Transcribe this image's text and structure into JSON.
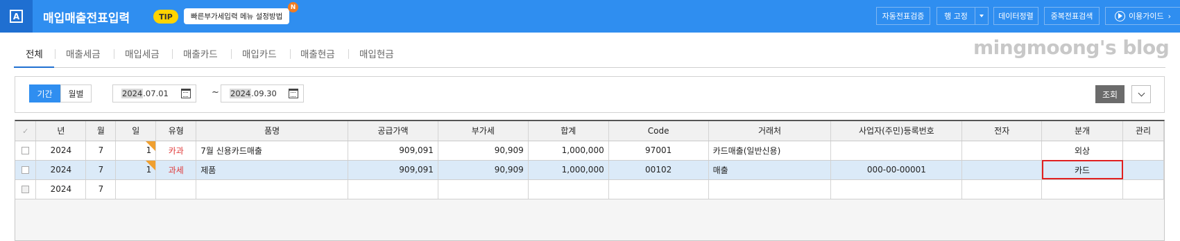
{
  "header": {
    "logo_letter": "A",
    "title": "매입매출전표입력",
    "tip_label": "TIP",
    "tip_text": "빠른부가세입력 메뉴 설정방법",
    "tip_new_badge": "N",
    "buttons": {
      "auto_verify": "자동전표검증",
      "row_fix": "행 고정",
      "data_sort": "데이터정렬",
      "dup_search": "중복전표검색",
      "guide": "이용가이드"
    }
  },
  "tabs": [
    {
      "label": "전체",
      "active": true
    },
    {
      "label": "매출세금",
      "active": false
    },
    {
      "label": "매입세금",
      "active": false
    },
    {
      "label": "매출카드",
      "active": false
    },
    {
      "label": "매입카드",
      "active": false
    },
    {
      "label": "매출현금",
      "active": false
    },
    {
      "label": "매입현금",
      "active": false
    }
  ],
  "watermark": "mingmoong's blog",
  "filter": {
    "period_label": "기간",
    "monthly_label": "월별",
    "from_year": "2024",
    "from_rest": ".07.01",
    "tilde": "~",
    "to_year": "2024",
    "to_rest": ".09.30",
    "search_label": "조회"
  },
  "grid": {
    "check_all": "✓",
    "columns": [
      "년",
      "월",
      "일",
      "유형",
      "품명",
      "공급가액",
      "부가세",
      "합계",
      "Code",
      "거래처",
      "사업자(주민)등록번호",
      "전자",
      "분개",
      "관리"
    ],
    "rows": [
      {
        "year": "2024",
        "month": "7",
        "day": "1",
        "type": "카과",
        "item": "7월 신용카드매출",
        "supply": "909,091",
        "vat": "90,909",
        "total": "1,000,000",
        "code": "97001",
        "partner": "카드매출(일반신용)",
        "regno": "",
        "elec": "",
        "journal": "외상",
        "manage": ""
      },
      {
        "year": "2024",
        "month": "7",
        "day": "1",
        "type": "과세",
        "item": "제품",
        "supply": "909,091",
        "vat": "90,909",
        "total": "1,000,000",
        "code": "00102",
        "partner": "매출",
        "regno": "000-00-00001",
        "elec": "",
        "journal": "카드",
        "manage": ""
      },
      {
        "year": "2024",
        "month": "7",
        "day": "",
        "type": "",
        "item": "",
        "supply": "",
        "vat": "",
        "total": "",
        "code": "",
        "partner": "",
        "regno": "",
        "elec": "",
        "journal": "",
        "manage": ""
      }
    ]
  },
  "colors": {
    "header_bg": "#2f8ef0",
    "accent": "#1f6fd1",
    "selected_row": "#dbeaf8",
    "focus_outline": "#e02020",
    "type_text": "#e03a3a"
  }
}
